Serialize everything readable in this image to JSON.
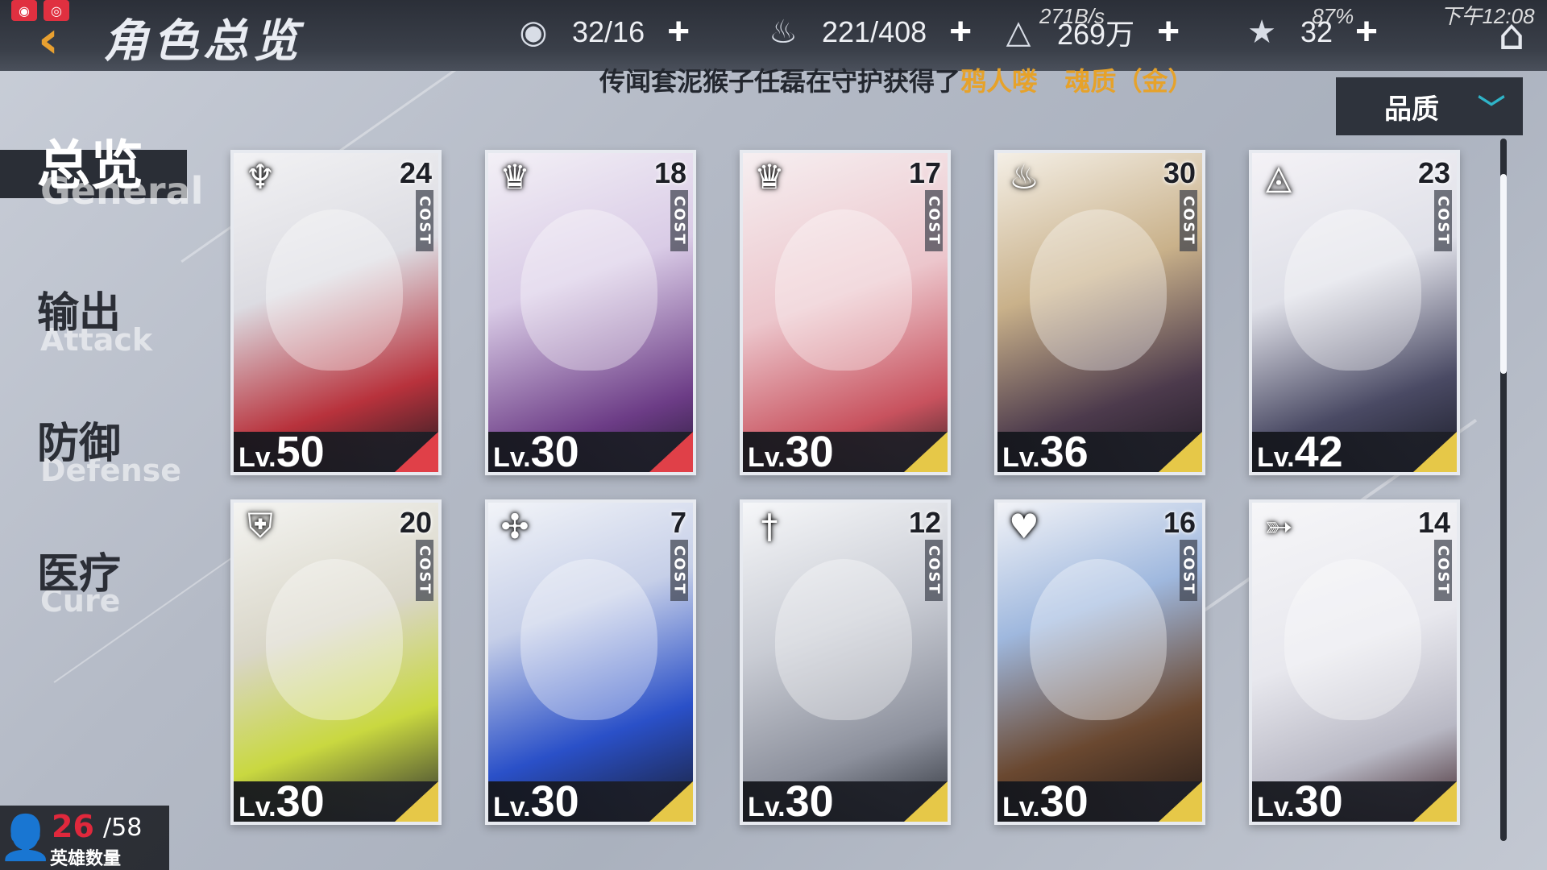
{
  "status_bar": {
    "network_speed": "271B/s",
    "battery": "87%",
    "time": "下午12:08"
  },
  "header": {
    "title": "角色总览",
    "resources": [
      {
        "icon": "eye-icon",
        "value": "32/16"
      },
      {
        "icon": "flame-icon",
        "value": "221/408"
      },
      {
        "icon": "triangle-crystal-icon",
        "value": "269万"
      },
      {
        "icon": "star-icon",
        "value": "32"
      }
    ]
  },
  "marquee": {
    "prefix": "传闻套泥猴子任磊在守护获得了",
    "item": "鸦人喽",
    "quality": "魂质（金）"
  },
  "sort": {
    "selected": "品质",
    "chevron": "chevron-down-icon"
  },
  "nav": [
    {
      "cn": "总览",
      "en": "General",
      "active": true
    },
    {
      "cn": "输出",
      "en": "Attack",
      "active": false
    },
    {
      "cn": "防御",
      "en": "Defense",
      "active": false
    },
    {
      "cn": "医疗",
      "en": "Cure",
      "active": false
    }
  ],
  "heroes": [
    {
      "class_icon": "demon-horns-icon",
      "cost": "24",
      "cost_label": "COST",
      "lv_prefix": "Lv.",
      "level": "50",
      "rarity_color": "#e04048"
    },
    {
      "class_icon": "crown-emblem-icon",
      "cost": "18",
      "cost_label": "COST",
      "lv_prefix": "Lv.",
      "level": "30",
      "rarity_color": "#e04048"
    },
    {
      "class_icon": "crown-emblem-icon",
      "cost": "17",
      "cost_label": "COST",
      "lv_prefix": "Lv.",
      "level": "30",
      "rarity_color": "#e6c848"
    },
    {
      "class_icon": "flame-emblem-icon",
      "cost": "30",
      "cost_label": "COST",
      "lv_prefix": "Lv.",
      "level": "36",
      "rarity_color": "#e6c848"
    },
    {
      "class_icon": "fox-mask-icon",
      "cost": "23",
      "cost_label": "COST",
      "lv_prefix": "Lv.",
      "level": "42",
      "rarity_color": "#e6c848"
    },
    {
      "class_icon": "shield-cross-icon",
      "cost": "20",
      "cost_label": "COST",
      "lv_prefix": "Lv.",
      "level": "30",
      "rarity_color": "#e6c848"
    },
    {
      "class_icon": "shuriken-icon",
      "cost": "7",
      "cost_label": "COST",
      "lv_prefix": "Lv.",
      "level": "30",
      "rarity_color": "#e6c848"
    },
    {
      "class_icon": "sword-icon",
      "cost": "12",
      "cost_label": "COST",
      "lv_prefix": "Lv.",
      "level": "30",
      "rarity_color": "#e6c848"
    },
    {
      "class_icon": "heart-wings-icon",
      "cost": "16",
      "cost_label": "COST",
      "lv_prefix": "Lv.",
      "level": "30",
      "rarity_color": "#e6c848"
    },
    {
      "class_icon": "bow-icon",
      "cost": "14",
      "cost_label": "COST",
      "lv_prefix": "Lv.",
      "level": "30",
      "rarity_color": "#e6c848"
    }
  ],
  "hero_count": {
    "current": "26",
    "max": "/58",
    "label": "英雄数量"
  }
}
